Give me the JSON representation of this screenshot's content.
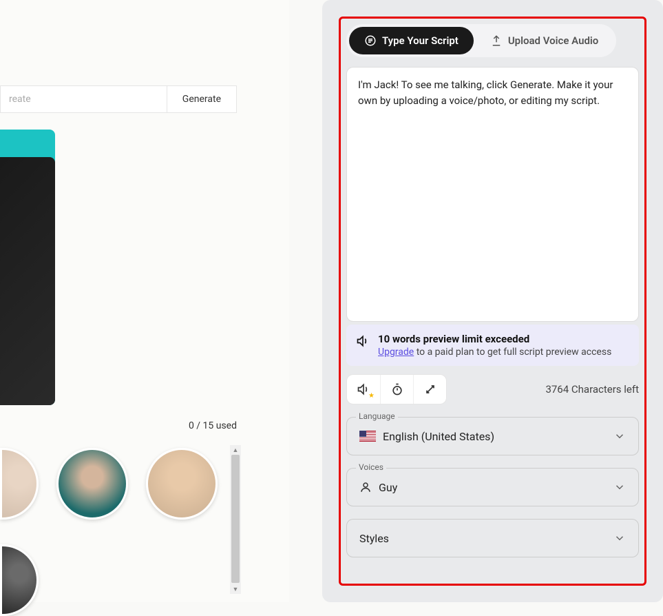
{
  "left": {
    "top_label": "reate",
    "generate_button": "Generate",
    "usage": "0 / 15 used"
  },
  "tabs": {
    "type_script": "Type Your Script",
    "upload_audio": "Upload Voice Audio"
  },
  "script": {
    "value": "I'm Jack! To see me talking, click Generate. Make it your own by uploading a voice/photo, or editing my script."
  },
  "warning": {
    "title": "10 words preview limit exceeded",
    "link_text": "Upgrade",
    "suffix": " to a paid plan to get full script preview access"
  },
  "chars_left": "3764 Characters left",
  "selects": {
    "language": {
      "legend": "Language",
      "value": "English (United States)"
    },
    "voices": {
      "legend": "Voices",
      "value": "Guy"
    },
    "styles": {
      "value": "Styles"
    }
  }
}
